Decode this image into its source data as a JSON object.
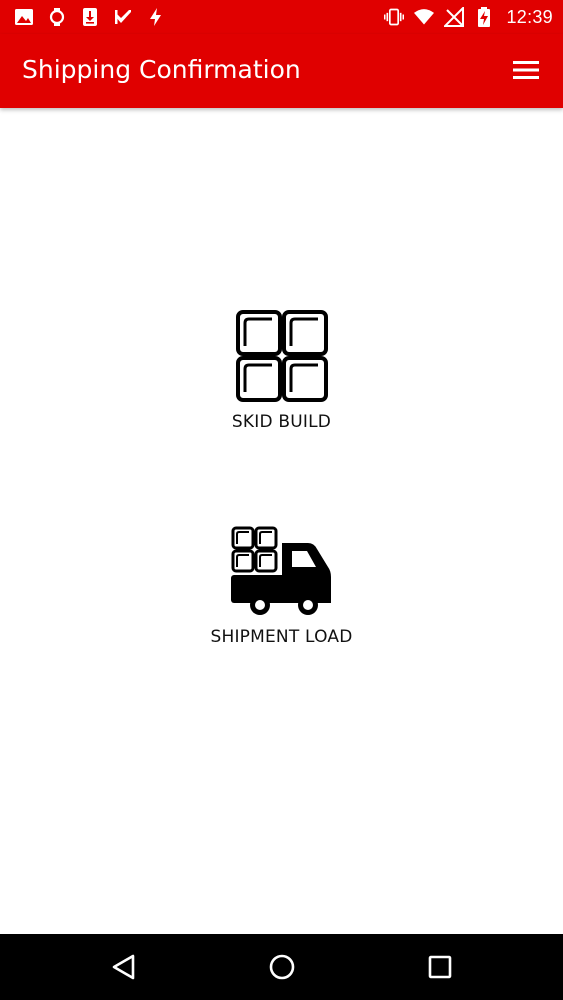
{
  "status_bar": {
    "time": "12:39",
    "left_icons": [
      "image-icon",
      "watch-icon",
      "download-icon",
      "check-icon",
      "flash-icon"
    ],
    "right_icons": [
      "vibrate-icon",
      "wifi-icon",
      "no-signal-icon",
      "battery-charging-icon"
    ]
  },
  "app_bar": {
    "title": "Shipping Confirmation",
    "menu_icon": "hamburger-menu-icon"
  },
  "tiles": [
    {
      "label": "SKID BUILD",
      "icon": "skid-build-icon"
    },
    {
      "label": "SHIPMENT LOAD",
      "icon": "truck-icon"
    }
  ],
  "nav_bar": {
    "buttons": [
      "back-icon",
      "home-icon",
      "recents-icon"
    ]
  },
  "colors": {
    "primary": "#e00000",
    "nav_background": "#000000",
    "text": "#111111"
  }
}
